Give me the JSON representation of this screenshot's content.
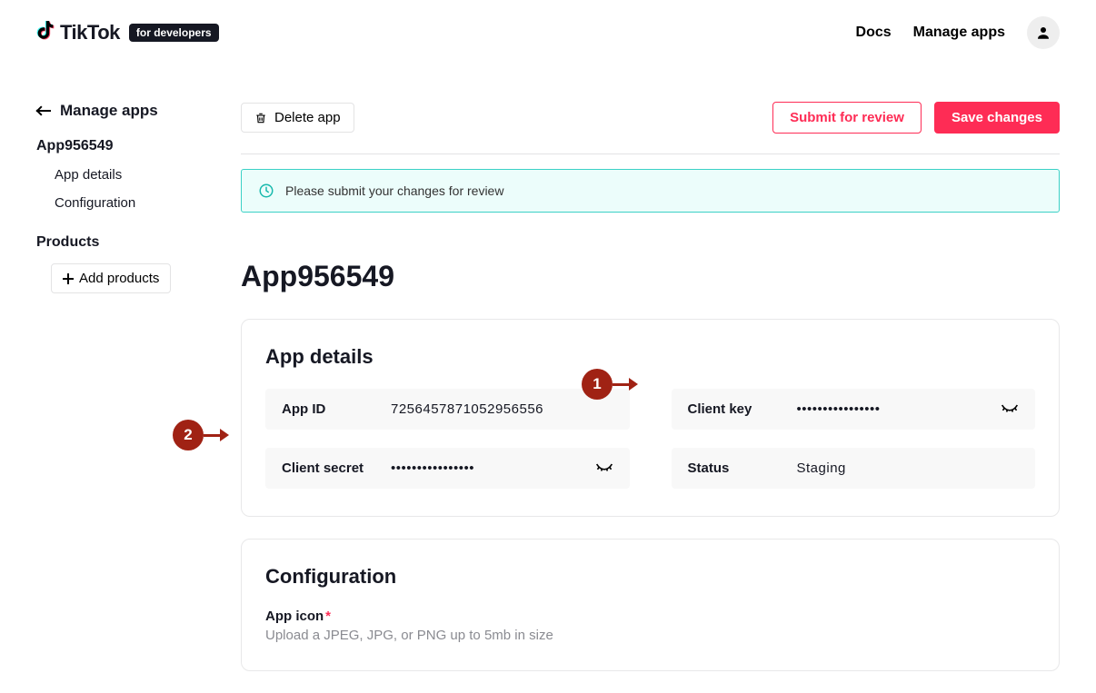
{
  "header": {
    "brand": "TikTok",
    "badge": "for developers",
    "nav": {
      "docs": "Docs",
      "manage": "Manage apps"
    }
  },
  "sidebar": {
    "back": "Manage apps",
    "appName": "App956549",
    "items": {
      "details": "App details",
      "config": "Configuration"
    },
    "products_heading": "Products",
    "add_products": "Add products"
  },
  "actions": {
    "delete": "Delete app",
    "submit": "Submit for review",
    "save": "Save changes"
  },
  "notice": "Please submit your changes for review",
  "page_title": "App956549",
  "app_details": {
    "title": "App details",
    "app_id_label": "App ID",
    "app_id": "7256457871052956556",
    "client_key_label": "Client key",
    "client_key": "••••••••••••••••",
    "client_secret_label": "Client secret",
    "client_secret": "••••••••••••••••",
    "status_label": "Status",
    "status": "Staging"
  },
  "configuration": {
    "title": "Configuration",
    "icon_label": "App icon",
    "icon_hint": "Upload a JPEG, JPG, or PNG up to 5mb in size"
  },
  "markers": {
    "one": "1",
    "two": "2"
  }
}
